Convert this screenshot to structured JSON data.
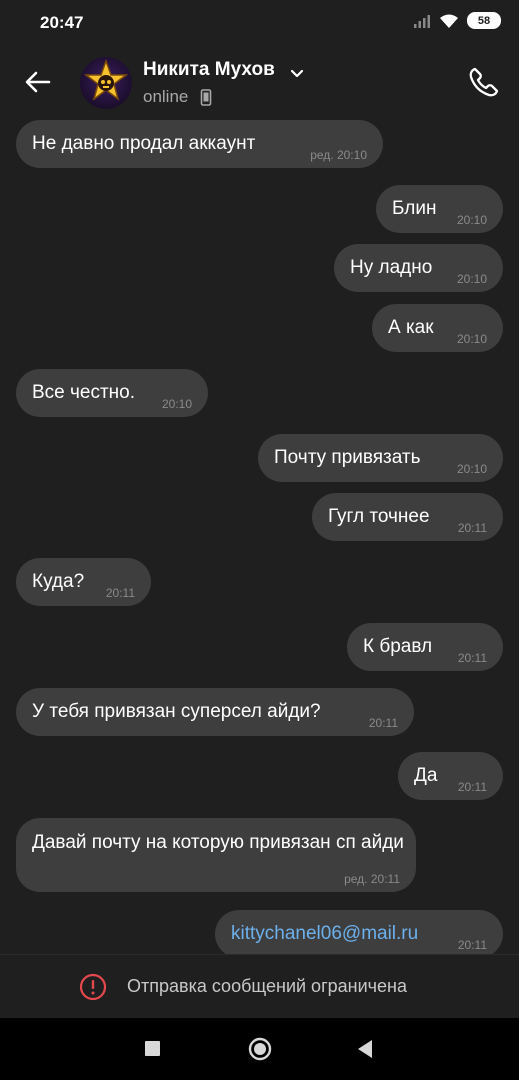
{
  "status_bar": {
    "time": "20:47",
    "battery": "58"
  },
  "header": {
    "contact_name": "Никита Мухов",
    "status": "online"
  },
  "messages": [
    {
      "text": "Не  давно продал аккаунт",
      "time": "ред. 20:10",
      "side": "in"
    },
    {
      "text": "Блин",
      "time": "20:10",
      "side": "out"
    },
    {
      "text": "Ну ладно",
      "time": "20:10",
      "side": "out"
    },
    {
      "text": "А как",
      "time": "20:10",
      "side": "out"
    },
    {
      "text": "Все честно.",
      "time": "20:10",
      "side": "in"
    },
    {
      "text": "Почту привязать",
      "time": "20:10",
      "side": "out"
    },
    {
      "text": "Гугл точнее",
      "time": "20:11",
      "side": "out"
    },
    {
      "text": "Куда?",
      "time": "20:11",
      "side": "in"
    },
    {
      "text": "К бравл",
      "time": "20:11",
      "side": "out"
    },
    {
      "text": "У тебя привязан суперсел айди?",
      "time": "20:11",
      "side": "in"
    },
    {
      "text": "Да",
      "time": "20:11",
      "side": "out"
    },
    {
      "text": "Давай почту на которую привязан сп айди",
      "time": "ред. 20:11",
      "side": "in"
    },
    {
      "text": "kittychanel06@mail.ru",
      "time": "20:11",
      "side": "out",
      "link": true
    }
  ],
  "restriction": {
    "text": "Отправка сообщений ограничена",
    "icon": "alert-circle-icon",
    "color": "#e5484d"
  },
  "colors": {
    "background": "#1f1f1f",
    "bubble": "#3e3e3e",
    "link": "#6cb0ec"
  }
}
